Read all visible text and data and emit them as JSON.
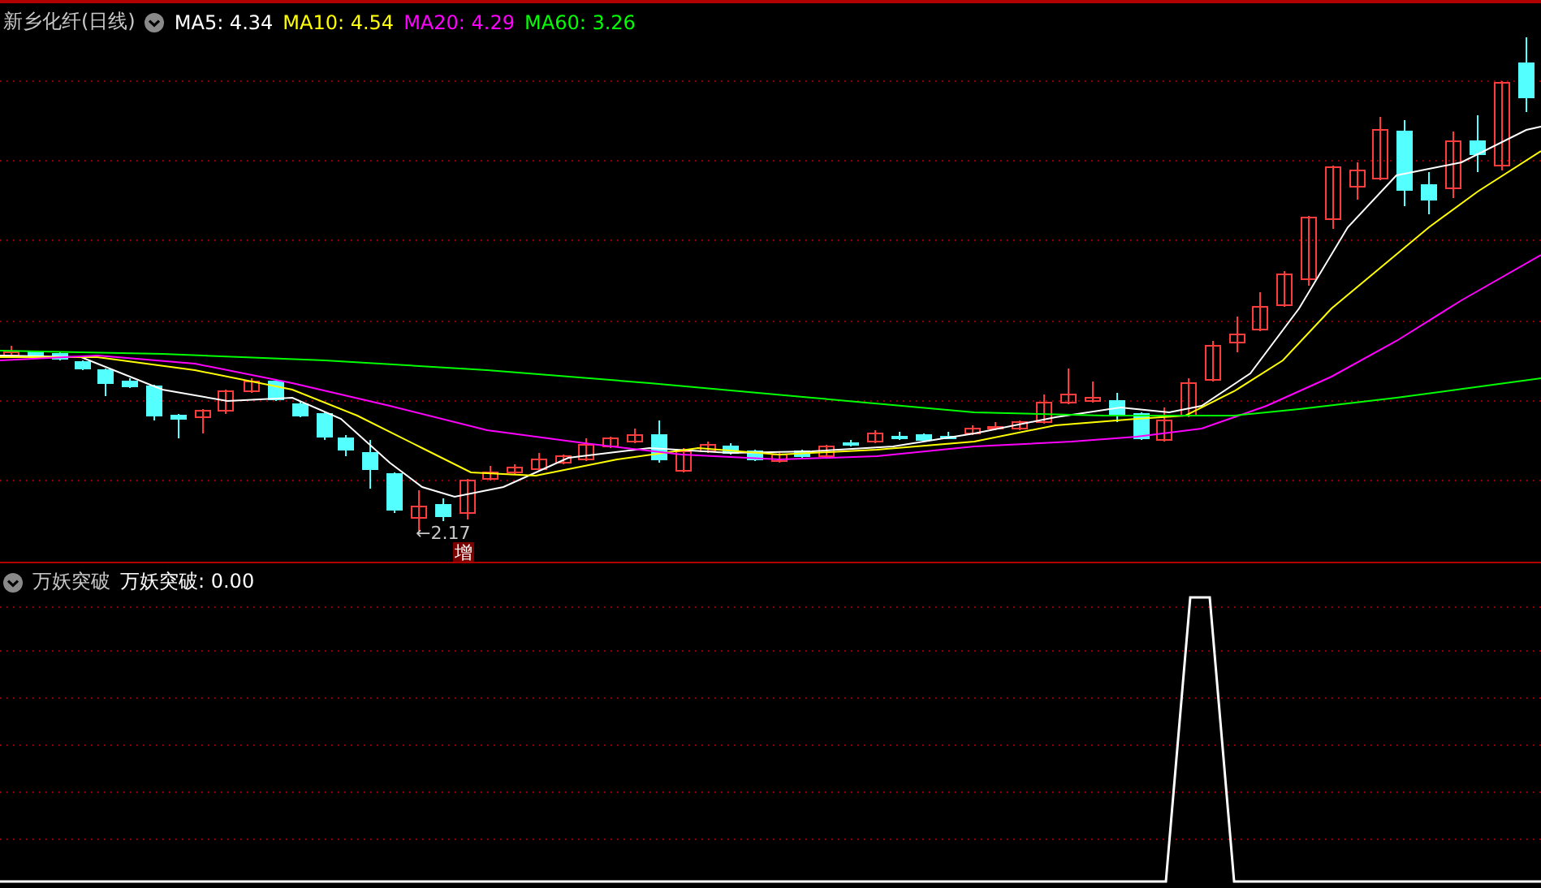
{
  "price_panel": {
    "title": "新乡化纤(日线)",
    "legend": [
      {
        "text": "MA5: 4.34",
        "color": "#ffffff"
      },
      {
        "text": "MA10: 4.54",
        "color": "#ffff00"
      },
      {
        "text": "MA20: 4.29",
        "color": "#ff00ff"
      },
      {
        "text": "MA60: 3.26",
        "color": "#00ff00"
      }
    ],
    "low_marker": "←2.17",
    "badge": "增"
  },
  "indicator_panel": {
    "title": "万妖突破",
    "legend": [
      {
        "text": "万妖突破: 0.00",
        "color": "#ffffff"
      }
    ]
  }
}
